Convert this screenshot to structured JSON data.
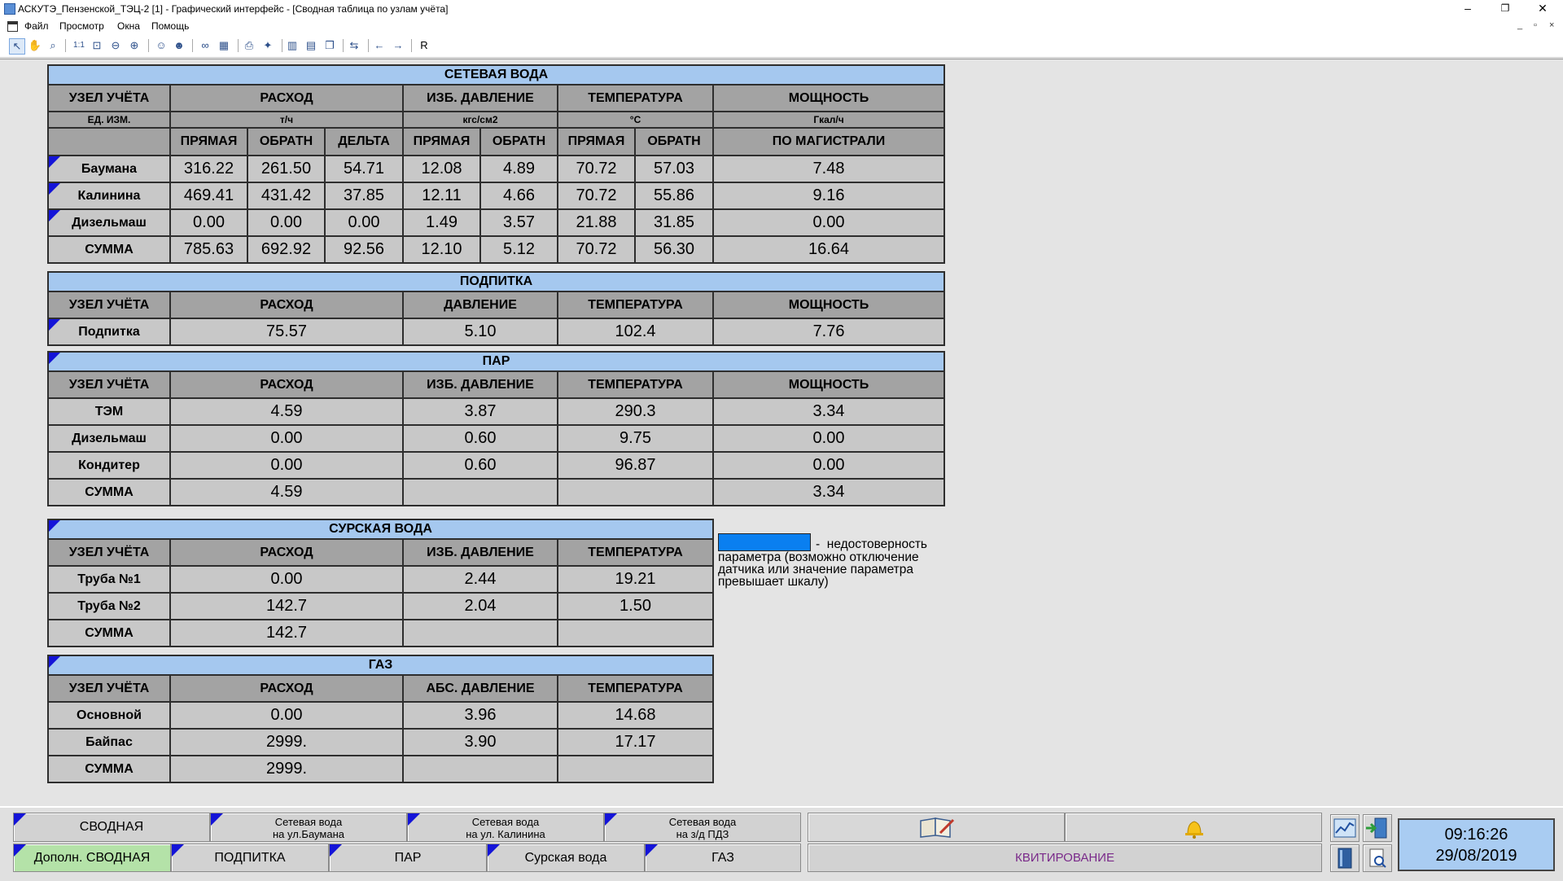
{
  "window": {
    "title": "АСКУТЭ_Пензенской_ТЭЦ-2 [1] - Графический интерфейс - [Сводная таблица по узлам учёта]",
    "minimize": "–",
    "restore": "❐",
    "close": "✕"
  },
  "menu": {
    "file": "Файл",
    "view": "Просмотр",
    "windows": "Окна",
    "help": "Помощь"
  },
  "toolbar": {
    "r_label": "R"
  },
  "net_water": {
    "title": "СЕТЕВАЯ ВОДА",
    "col_node": "УЗЕЛ УЧЁТА",
    "col_flow": "РАСХОД",
    "col_pressure": "ИЗБ. ДАВЛЕНИЕ",
    "col_temp": "ТЕМПЕРАТУРА",
    "col_power": "МОЩНОСТЬ",
    "units_label": "ЕД. ИЗМ.",
    "unit_flow": "т/ч",
    "unit_pressure": "кгс/см2",
    "unit_temp": "°С",
    "unit_power": "Гкал/ч",
    "sub_direct": "ПРЯМАЯ",
    "sub_return": "ОБРАТН",
    "sub_delta": "ДЕЛЬТА",
    "sub_main": "ПО МАГИСТРАЛИ",
    "rows": [
      {
        "name": "Баумана",
        "f1": "316.22",
        "f2": "261.50",
        "fd": "54.71",
        "p1": "12.08",
        "p2": "4.89",
        "t1": "70.72",
        "t2": "57.03",
        "q": "7.48"
      },
      {
        "name": "Калинина",
        "f1": "469.41",
        "f2": "431.42",
        "fd": "37.85",
        "p1": "12.11",
        "p2": "4.66",
        "t1": "70.72",
        "t2": "55.86",
        "q": "9.16"
      },
      {
        "name": "Дизельмаш",
        "f1": "0.00",
        "f2": "0.00",
        "fd": "0.00",
        "p1": "1.49",
        "p2": "3.57",
        "t1": "21.88",
        "t2": "31.85",
        "q": "0.00"
      },
      {
        "name": "СУММА",
        "f1": "785.63",
        "f2": "692.92",
        "fd": "92.56",
        "p1": "12.10",
        "p2": "5.12",
        "t1": "70.72",
        "t2": "56.30",
        "q": "16.64"
      }
    ]
  },
  "makeup": {
    "title": "ПОДПИТКА",
    "col_node": "УЗЕЛ УЧЁТА",
    "col_flow": "РАСХОД",
    "col_pressure": "ДАВЛЕНИЕ",
    "col_temp": "ТЕМПЕРАТУРА",
    "col_power": "МОЩНОСТЬ",
    "row": {
      "name": "Подпитка",
      "flow": "75.57",
      "pressure": "5.10",
      "temp": "102.4",
      "power": "7.76"
    }
  },
  "steam": {
    "title": "ПАР",
    "col_node": "УЗЕЛ УЧЁТА",
    "col_flow": "РАСХОД",
    "col_pressure": "ИЗБ. ДАВЛЕНИЕ",
    "col_temp": "ТЕМПЕРАТУРА",
    "col_power": "МОЩНОСТЬ",
    "rows": [
      {
        "name": "ТЭМ",
        "flow": "4.59",
        "pressure": "3.87",
        "temp": "290.3",
        "power": "3.34"
      },
      {
        "name": "Дизельмаш",
        "flow": "0.00",
        "pressure": "0.60",
        "temp": "9.75",
        "power": "0.00"
      },
      {
        "name": "Кондитер",
        "flow": "0.00",
        "pressure": "0.60",
        "temp": "96.87",
        "power": "0.00"
      },
      {
        "name": "СУММА",
        "flow": "4.59",
        "pressure": "",
        "temp": "",
        "power": "3.34"
      }
    ]
  },
  "sura_water": {
    "title": "СУРСКАЯ ВОДА",
    "col_node": "УЗЕЛ УЧЁТА",
    "col_flow": "РАСХОД",
    "col_pressure": "ИЗБ. ДАВЛЕНИЕ",
    "col_temp": "ТЕМПЕРАТУРА",
    "rows": [
      {
        "name": "Труба №1",
        "flow": "0.00",
        "pressure": "2.44",
        "temp": "19.21"
      },
      {
        "name": "Труба №2",
        "flow": "142.7",
        "pressure": "2.04",
        "temp": "1.50"
      },
      {
        "name": "СУММА",
        "flow": "142.7",
        "pressure": "",
        "temp": ""
      }
    ]
  },
  "gas": {
    "title": "ГАЗ",
    "col_node": "УЗЕЛ УЧЁТА",
    "col_flow": "РАСХОД",
    "col_pressure": "АБС. ДАВЛЕНИЕ",
    "col_temp": "ТЕМПЕРАТУРА",
    "rows": [
      {
        "name": "Основной",
        "flow": "0.00",
        "pressure": "3.96",
        "temp": "14.68"
      },
      {
        "name": "Байпас",
        "flow": "2999.",
        "pressure": "3.90",
        "temp": "17.17"
      },
      {
        "name": "СУММА",
        "flow": "2999.",
        "pressure": "",
        "temp": ""
      }
    ]
  },
  "legend": {
    "dash": "-",
    "text": "недостоверность параметра (возможно отключение датчика или значение параметра превышает шкалу)",
    "swatch_color": "#0a7ff0"
  },
  "nav": {
    "summary": "СВОДНАЯ",
    "net_baumana_1": "Сетевая вода",
    "net_baumana_2": "на ул.Баумана",
    "net_kalinina_1": "Сетевая вода",
    "net_kalinina_2": "на ул. Калинина",
    "net_pdz_1": "Сетевая вода",
    "net_pdz_2": "на з/д ПДЗ",
    "extra_summary": "Дополн. СВОДНАЯ",
    "makeup": "ПОДПИТКА",
    "steam": "ПАР",
    "sura": "Сурская вода",
    "gas": "ГАЗ",
    "ack": "КВИТИРОВАНИЕ"
  },
  "clock": {
    "time": "09:16:26",
    "date": "29/08/2019"
  },
  "colors": {
    "header_blue": "#a5c8ef",
    "flag_blue": "#1414d8",
    "active_green": "#b4e2a8",
    "ack_text": "#7a2a8a"
  }
}
